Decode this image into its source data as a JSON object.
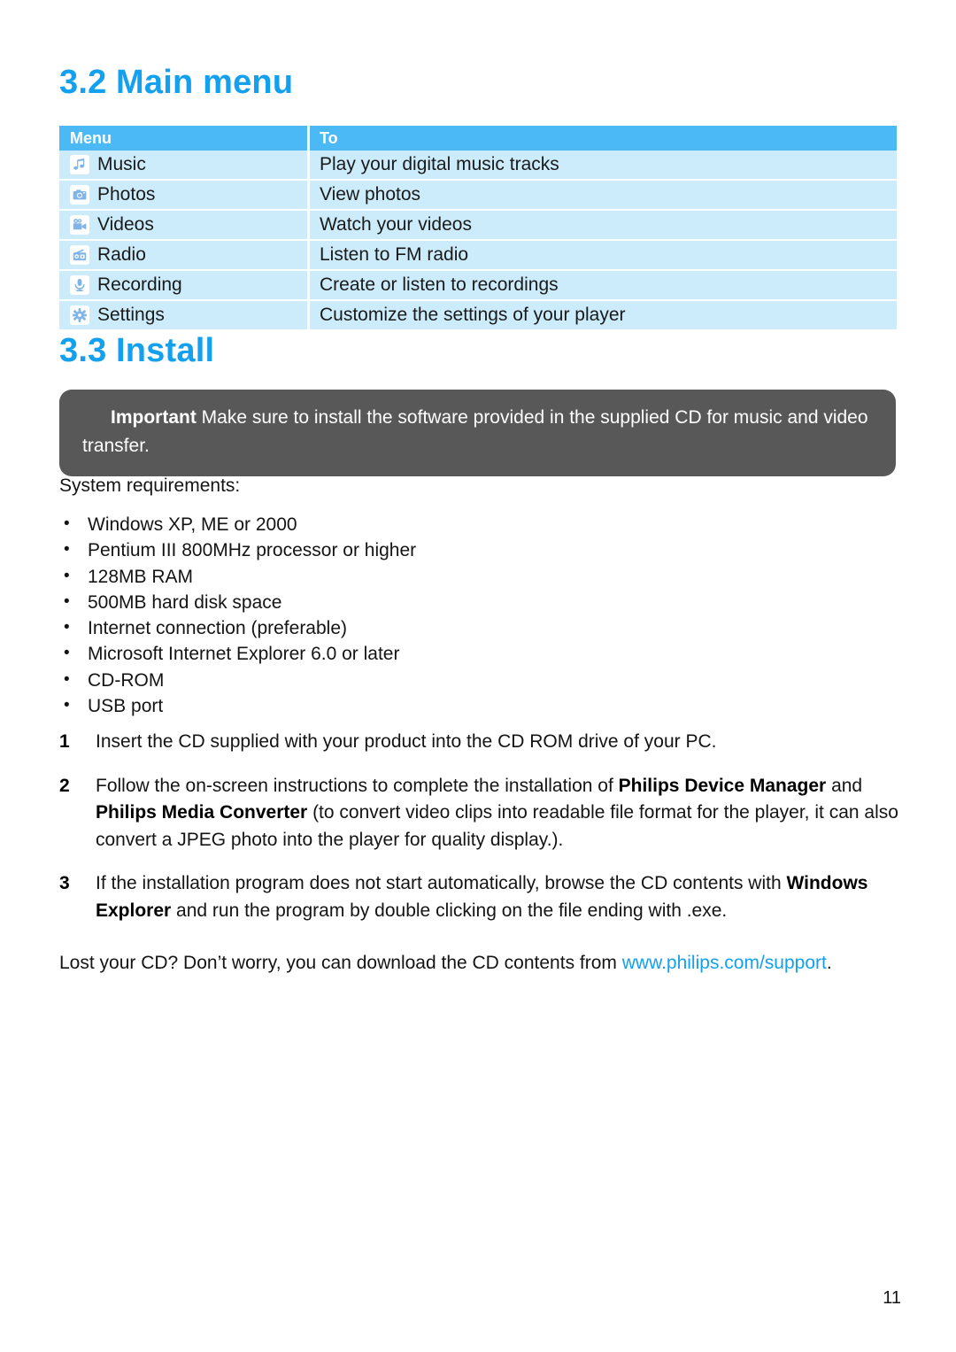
{
  "sections": {
    "main_menu": {
      "number": "3.2",
      "title": "Main menu"
    },
    "install": {
      "number": "3.3",
      "title": "Install"
    }
  },
  "menu_table": {
    "headers": {
      "menu": "Menu",
      "to": "To"
    },
    "rows": [
      {
        "icon": "music-note-icon",
        "menu": "Music",
        "to": "Play your digital music tracks"
      },
      {
        "icon": "camera-icon",
        "menu": "Photos",
        "to": "View photos"
      },
      {
        "icon": "video-camera-icon",
        "menu": "Videos",
        "to": "Watch your videos"
      },
      {
        "icon": "radio-icon",
        "menu": "Radio",
        "to": "Listen to FM radio"
      },
      {
        "icon": "microphone-icon",
        "menu": "Recording",
        "to": "Create or listen to recordings"
      },
      {
        "icon": "gear-icon",
        "menu": "Settings",
        "to": "Customize the settings of your player"
      }
    ]
  },
  "important": {
    "label": "Important",
    "text": " Make sure to install the software provided in the supplied CD for music and video transfer."
  },
  "system_requirements": {
    "label": "System requirements:",
    "items": [
      "Windows XP, ME or 2000",
      "Pentium III 800MHz processor or higher",
      "128MB RAM",
      "500MB hard disk space",
      "Internet connection (preferable)",
      "Microsoft Internet Explorer 6.0 or later",
      "CD-ROM",
      "USB port"
    ]
  },
  "steps": [
    {
      "number": "1",
      "parts": [
        {
          "text": "Insert the CD supplied with your product into the CD ROM drive of your PC.",
          "bold": false
        }
      ]
    },
    {
      "number": "2",
      "parts": [
        {
          "text": "Follow the on-screen instructions to complete the installation of ",
          "bold": false
        },
        {
          "text": "Philips Device Manager",
          "bold": true
        },
        {
          "text": " and ",
          "bold": false
        },
        {
          "text": "Philips Media Converter",
          "bold": true
        },
        {
          "text": " (to convert video clips into readable file format for the player, it can also convert a JPEG photo into the player for quality display.).",
          "bold": false
        }
      ]
    },
    {
      "number": "3",
      "parts": [
        {
          "text": "If the installation program does not start automatically, browse the CD contents with ",
          "bold": false
        },
        {
          "text": "Windows Explorer",
          "bold": true
        },
        {
          "text": " and run the program by double clicking on the file ending with .exe.",
          "bold": false
        }
      ]
    }
  ],
  "closing": {
    "text_before": "Lost your CD? Don’t worry, you can download the CD contents from ",
    "link": "www.philips.com/support",
    "text_after": "."
  },
  "page_number": "11",
  "colors": {
    "accent_blue": "#12a0ef",
    "table_header": "#4ab9f5",
    "table_row": "#cdecfb",
    "callout_bg": "#585858",
    "icon_glyph": "#7fb4e8"
  }
}
